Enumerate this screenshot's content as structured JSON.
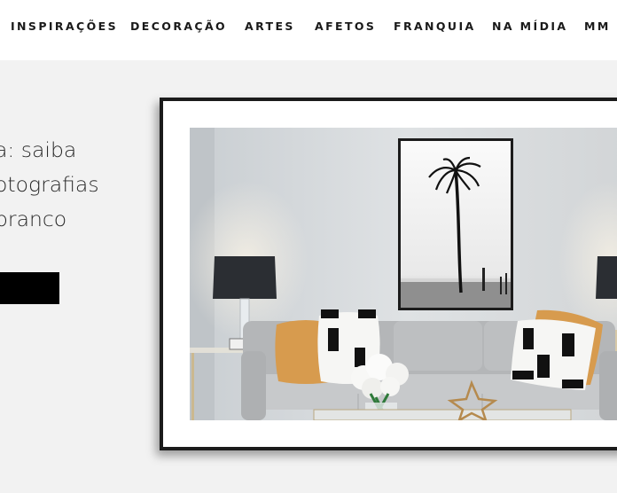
{
  "nav": {
    "items": [
      {
        "label": "INSPIRAÇÕES"
      },
      {
        "label": "DECORAÇÃO"
      },
      {
        "label": "ARTES"
      },
      {
        "label": "AFETOS"
      },
      {
        "label": "FRANQUIA"
      },
      {
        "label": "NA MÍDIA"
      },
      {
        "label": "MM E"
      }
    ]
  },
  "hero": {
    "lines": [
      "a: saiba",
      "otografias",
      "branco"
    ],
    "cta_label": ""
  },
  "artwork": {
    "subject": "living-room-photo",
    "poster_icon": "palm-tree-icon"
  },
  "colors": {
    "background": "#f2f2f2",
    "nav_bg": "#ffffff",
    "text": "#1a1a1a",
    "frame": "#1b1b1b",
    "button": "#000000"
  }
}
